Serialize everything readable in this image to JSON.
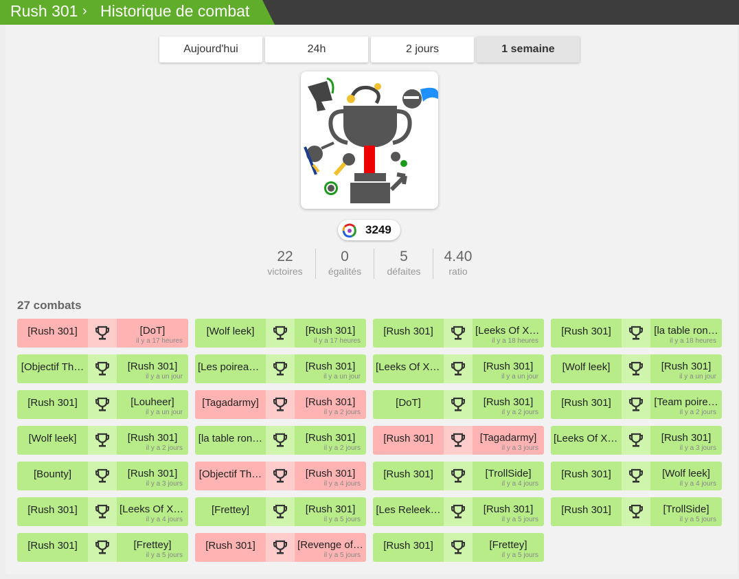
{
  "header": {
    "farmer": "Rush 301",
    "separator": "›",
    "page_title": "Historique de combat"
  },
  "periods": [
    {
      "label": "Aujourd'hui",
      "active": false
    },
    {
      "label": "24h",
      "active": false
    },
    {
      "label": "2 jours",
      "active": false
    },
    {
      "label": "1 semaine",
      "active": true
    }
  ],
  "talent": {
    "value": "3249",
    "icon": "talent-icon"
  },
  "stats": [
    {
      "value": "22",
      "label": "victoires"
    },
    {
      "value": "0",
      "label": "égalités"
    },
    {
      "value": "5",
      "label": "défaites"
    },
    {
      "value": "4.40",
      "label": "ratio"
    }
  ],
  "fight_count": "27 combats",
  "colors": {
    "win": "#b7ec88",
    "loss": "#ffb3b3",
    "brand": "#5fad2a"
  },
  "fights": [
    {
      "f1": "[Rush 301]",
      "f2": "[DoT]",
      "date": "il y a 17 heures",
      "result": "loss"
    },
    {
      "f1": "[Wolf leek]",
      "f2": "[Rush 301]",
      "date": "il y a 17 heures",
      "result": "win"
    },
    {
      "f1": "[Rush 301]",
      "f2": "[Leeks Of Xi…",
      "date": "il y a 18 heures",
      "result": "win"
    },
    {
      "f1": "[Rush 301]",
      "f2": "[la table ron…",
      "date": "il y a 18 heures",
      "result": "win"
    },
    {
      "f1": "[Objectif Th…",
      "f2": "[Rush 301]",
      "date": "il y a un jour",
      "result": "win"
    },
    {
      "f1": "[Les poireau…",
      "f2": "[Rush 301]",
      "date": "il y a un jour",
      "result": "win"
    },
    {
      "f1": "[Leeks Of Xi…",
      "f2": "[Rush 301]",
      "date": "il y a un jour",
      "result": "win"
    },
    {
      "f1": "[Wolf leek]",
      "f2": "[Rush 301]",
      "date": "il y a un jour",
      "result": "win"
    },
    {
      "f1": "[Rush 301]",
      "f2": "[Louheer]",
      "date": "il y a un jour",
      "result": "win"
    },
    {
      "f1": "[Tagadarmy]",
      "f2": "[Rush 301]",
      "date": "il y a 2 jours",
      "result": "loss"
    },
    {
      "f1": "[DoT]",
      "f2": "[Rush 301]",
      "date": "il y a 2 jours",
      "result": "win"
    },
    {
      "f1": "[Rush 301]",
      "f2": "[Team poire…",
      "date": "il y a 2 jours",
      "result": "win"
    },
    {
      "f1": "[Wolf leek]",
      "f2": "[Rush 301]",
      "date": "il y a 2 jours",
      "result": "win"
    },
    {
      "f1": "[la table ron…",
      "f2": "[Rush 301]",
      "date": "il y a 2 jours",
      "result": "win"
    },
    {
      "f1": "[Rush 301]",
      "f2": "[Tagadarmy]",
      "date": "il y a 3 jours",
      "result": "loss"
    },
    {
      "f1": "[Leeks Of Xi…",
      "f2": "[Rush 301]",
      "date": "il y a 3 jours",
      "result": "win"
    },
    {
      "f1": "[Bounty]",
      "f2": "[Rush 301]",
      "date": "il y a 3 jours",
      "result": "win"
    },
    {
      "f1": "[Objectif Th…",
      "f2": "[Rush 301]",
      "date": "il y a 4 jours",
      "result": "loss"
    },
    {
      "f1": "[Rush 301]",
      "f2": "[TrollSide]",
      "date": "il y a 4 jours",
      "result": "win"
    },
    {
      "f1": "[Rush 301]",
      "f2": "[Wolf leek]",
      "date": "il y a 4 jours",
      "result": "win"
    },
    {
      "f1": "[Rush 301]",
      "f2": "[Leeks Of Xi…",
      "date": "il y a 4 jours",
      "result": "win"
    },
    {
      "f1": "[Frettey]",
      "f2": "[Rush 301]",
      "date": "il y a 5 jours",
      "result": "win"
    },
    {
      "f1": "[Les Releek…",
      "f2": "[Rush 301]",
      "date": "il y a 5 jours",
      "result": "win"
    },
    {
      "f1": "[Rush 301]",
      "f2": "[TrollSide]",
      "date": "il y a 5 jours",
      "result": "win"
    },
    {
      "f1": "[Rush 301]",
      "f2": "[Frettey]",
      "date": "il y a 5 jours",
      "result": "win"
    },
    {
      "f1": "[Rush 301]",
      "f2": "[Revenge of…",
      "date": "il y a 5 jours",
      "result": "loss"
    },
    {
      "f1": "[Rush 301]",
      "f2": "[Frettey]",
      "date": "il y a 5 jours",
      "result": "win"
    }
  ]
}
